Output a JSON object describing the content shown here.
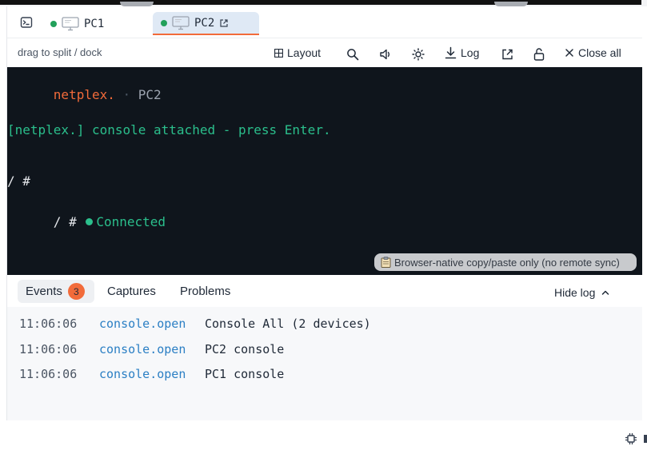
{
  "tabs": [
    {
      "label": "PC1",
      "status": "connected"
    },
    {
      "label": "PC2",
      "status": "connected",
      "active": true
    }
  ],
  "toolbar": {
    "hint": "drag to split / dock",
    "layout_label": "Layout",
    "log_label": "Log",
    "close_all_label": "Close all"
  },
  "terminal": {
    "brand": "netplex.",
    "separator": "·",
    "host": "PC2",
    "attach_message": "[netplex.] console attached - press Enter.",
    "prompt_line_1": "/ #",
    "prompt_line_2": "/ #",
    "status": "Connected",
    "clipboard_note": "Browser-native copy/paste only (no remote sync)"
  },
  "log": {
    "tabs": {
      "events": "Events",
      "events_count": "3",
      "captures": "Captures",
      "problems": "Problems"
    },
    "hide_label": "Hide log",
    "entries": [
      {
        "time": "11:06:06",
        "event": "console.open",
        "message": "Console All (2 devices)"
      },
      {
        "time": "11:06:06",
        "event": "console.open",
        "message": "PC2 console"
      },
      {
        "time": "11:06:06",
        "event": "console.open",
        "message": "PC1 console"
      }
    ]
  },
  "colors": {
    "accent": "#f26b3a",
    "terminal_bg": "#0f151c",
    "terminal_green": "#2bbf8c",
    "link_blue": "#2b7fc4",
    "status_dot": "#22a05a"
  },
  "icons": [
    "terminal-icon",
    "monitor-icon",
    "external-link-icon",
    "grid-icon",
    "search-icon",
    "volume-icon",
    "sun-icon",
    "download-icon",
    "lock-open-icon",
    "close-icon",
    "clipboard-icon",
    "chevron-up-icon",
    "chip-icon"
  ]
}
